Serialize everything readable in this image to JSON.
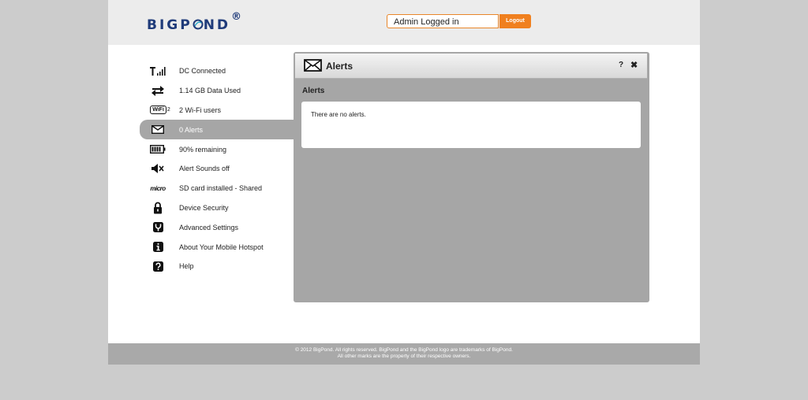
{
  "header": {
    "logo_text": "BIGP",
    "logo_text_after": "ND",
    "logo_reg": "®",
    "login_status": "Admin Logged in",
    "logout_label": "Logout"
  },
  "sidebar": {
    "items": [
      {
        "label": "DC Connected",
        "icon": "signal-icon"
      },
      {
        "label": "1.14 GB Data Used",
        "icon": "data-transfer-icon"
      },
      {
        "label": "2 Wi-Fi users",
        "icon": "wifi-icon"
      },
      {
        "label": "0 Alerts",
        "icon": "mail-icon"
      },
      {
        "label": "90% remaining",
        "icon": "battery-icon"
      },
      {
        "label": "Alert Sounds off",
        "icon": "speaker-muted-icon"
      },
      {
        "label": "SD card installed - Shared",
        "icon": "microsd-icon"
      },
      {
        "label": "Device Security",
        "icon": "lock-icon"
      },
      {
        "label": "Advanced Settings",
        "icon": "wrench-icon"
      },
      {
        "label": "About Your Mobile Hotspot",
        "icon": "info-icon"
      },
      {
        "label": "Help",
        "icon": "help-icon"
      }
    ],
    "wifi_badge": "2",
    "wifi_text": "WiFi",
    "micro_text": "micro"
  },
  "panel": {
    "title": "Alerts",
    "help": "?",
    "close": "✖",
    "section_heading": "Alerts",
    "message": "There are no alerts."
  },
  "footer": {
    "line1": "© 2012 BigPond. All rights reserved. BigPond and the BigPond logo are trademarks of BigPond.",
    "line2": "All other marks are the property of their respective owners."
  },
  "colors": {
    "accent": "#f0801f",
    "brand": "#1f3b7a",
    "panel_bg": "#a6a6a6"
  }
}
